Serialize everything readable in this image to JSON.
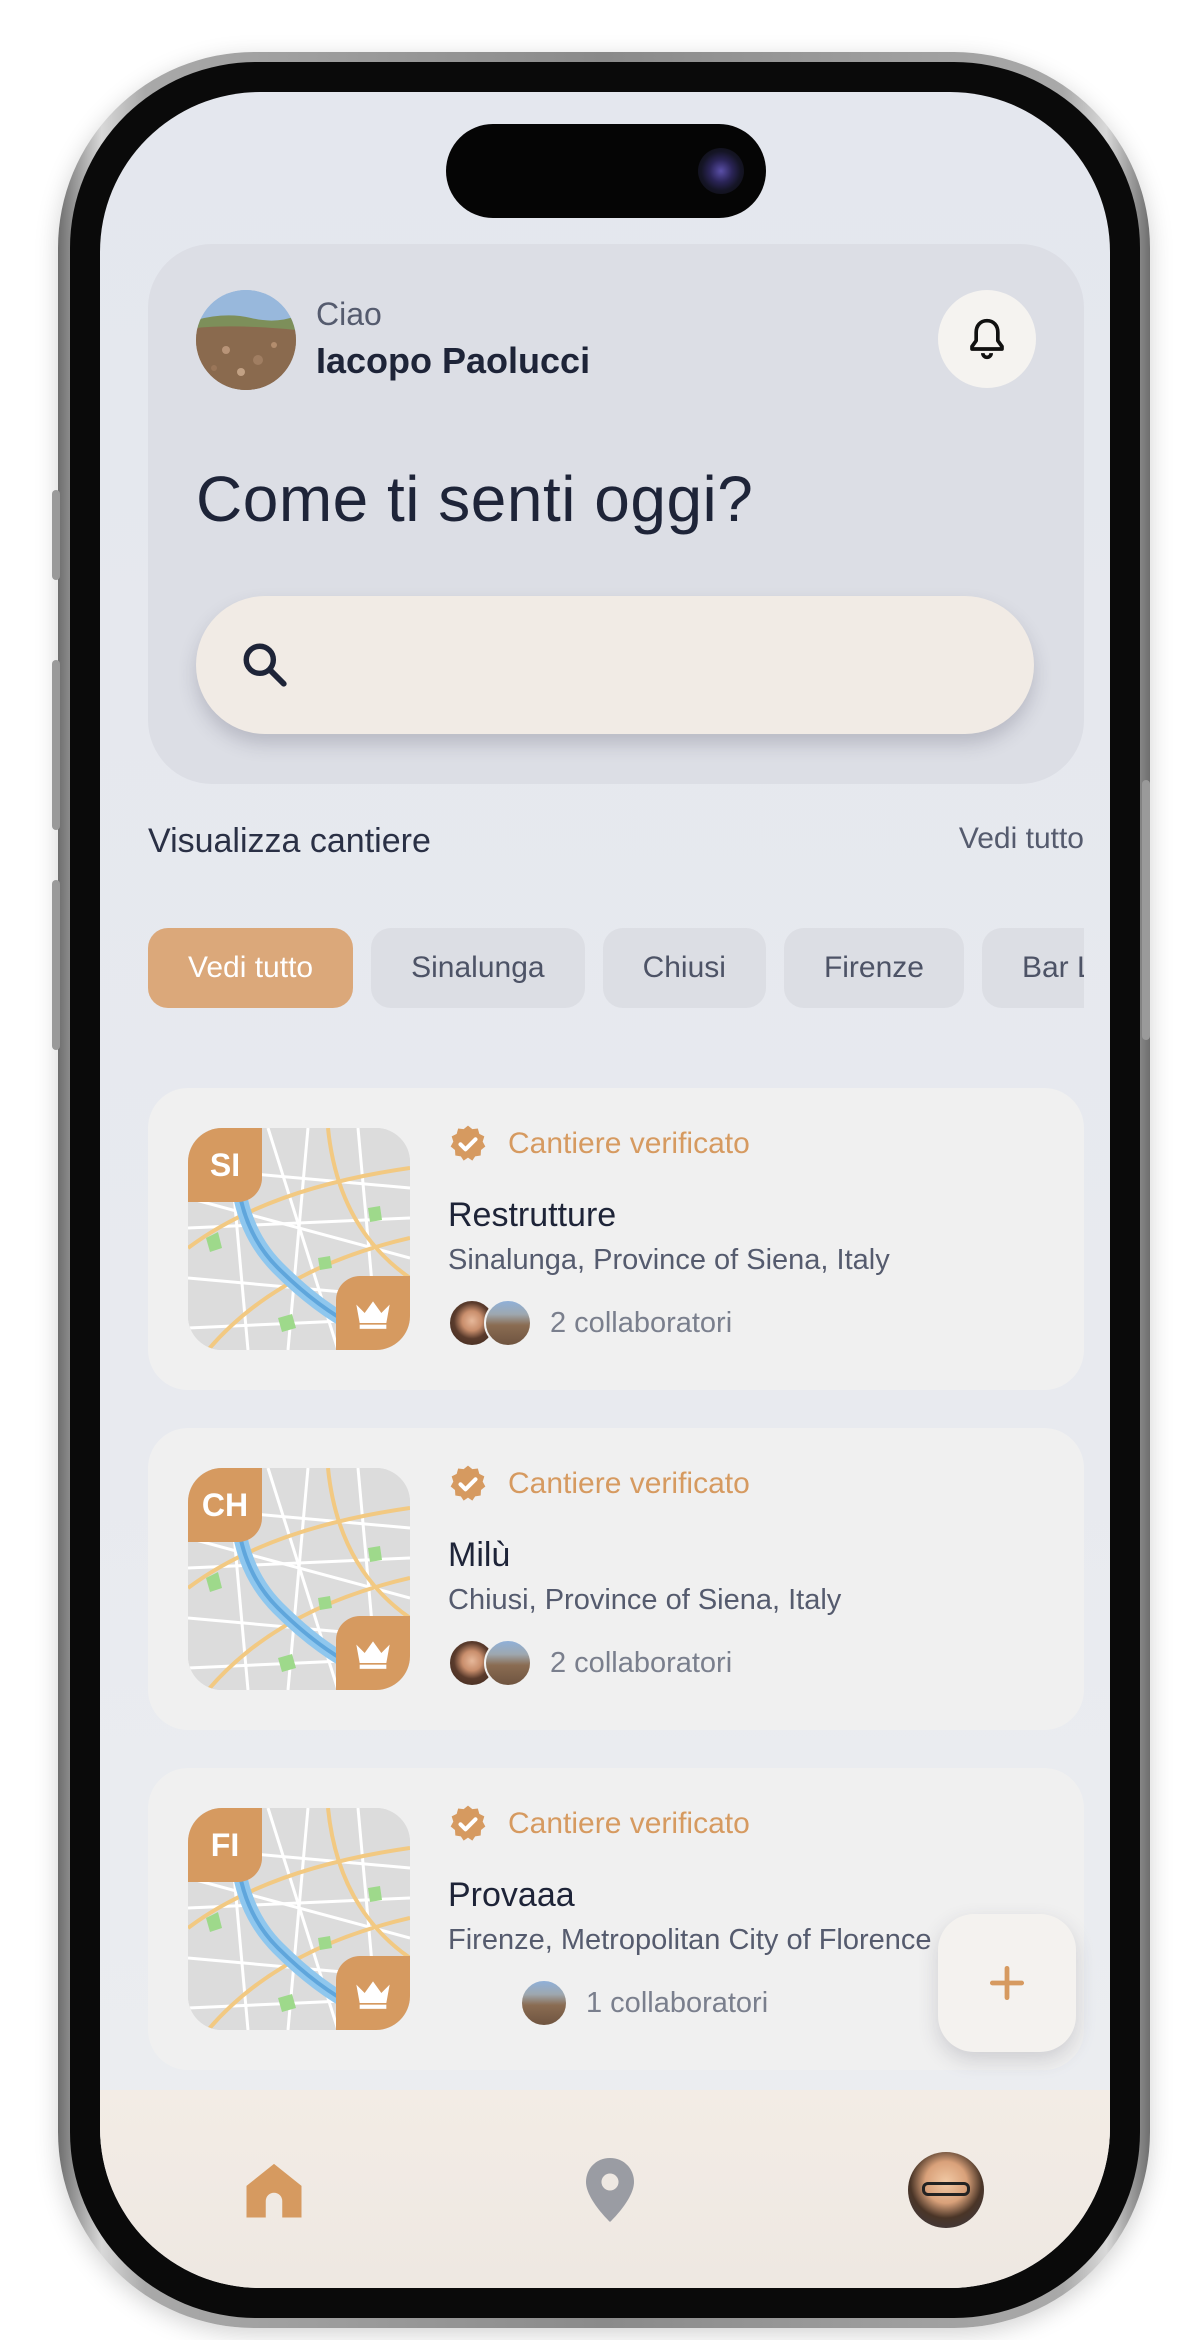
{
  "header": {
    "greeting": "Ciao",
    "user_name": "Iacopo Paolucci",
    "headline": "Come ti senti oggi?",
    "search_placeholder": ""
  },
  "section": {
    "title": "Visualizza cantiere",
    "see_all": "Vedi tutto"
  },
  "filters": [
    {
      "label": "Vedi tutto",
      "active": true
    },
    {
      "label": "Sinalunga",
      "active": false
    },
    {
      "label": "Chiusi",
      "active": false
    },
    {
      "label": "Firenze",
      "active": false
    },
    {
      "label": "Bar Lo",
      "active": false
    }
  ],
  "sites": [
    {
      "code": "SI",
      "verified_label": "Cantiere verificato",
      "name": "Restrutture",
      "location": "Sinalunga, Province of Siena, Italy",
      "collaborators": "2 collaboratori"
    },
    {
      "code": "CH",
      "verified_label": "Cantiere verificato",
      "name": "Milù",
      "location": "Chiusi, Province of Siena, Italy",
      "collaborators": "2 collaboratori"
    },
    {
      "code": "FI",
      "verified_label": "Cantiere verificato",
      "name": "Provaaa",
      "location": "Firenze, Metropolitan City of Florence",
      "collaborators": "1 collaboratori"
    }
  ],
  "nav": {
    "items": [
      "home-icon",
      "location-pin-icon",
      "profile-avatar"
    ]
  },
  "colors": {
    "accent": "#d69a60",
    "text_primary": "#1e2438",
    "background": "#e4e7ee"
  }
}
